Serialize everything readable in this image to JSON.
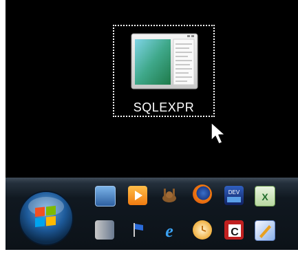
{
  "desktop": {
    "icon_label": "SQLEXPR",
    "icon_name": "application-window-icon",
    "selected": true
  },
  "taskbar": {
    "start_button": "windows-start-orb-icon",
    "quick_launch_row1": [
      "show-desktop-icon",
      "windows-media-player-icon",
      "gimp-icon",
      "firefox-icon",
      "dev-studio-icon",
      "excel-icon"
    ],
    "quick_launch_row2": [
      "windows-explorer-icon",
      "flag-icon",
      "internet-explorer-icon",
      "outlook-icon",
      "c-app-icon",
      "paint-icon"
    ],
    "accent_color": "#20303c"
  }
}
